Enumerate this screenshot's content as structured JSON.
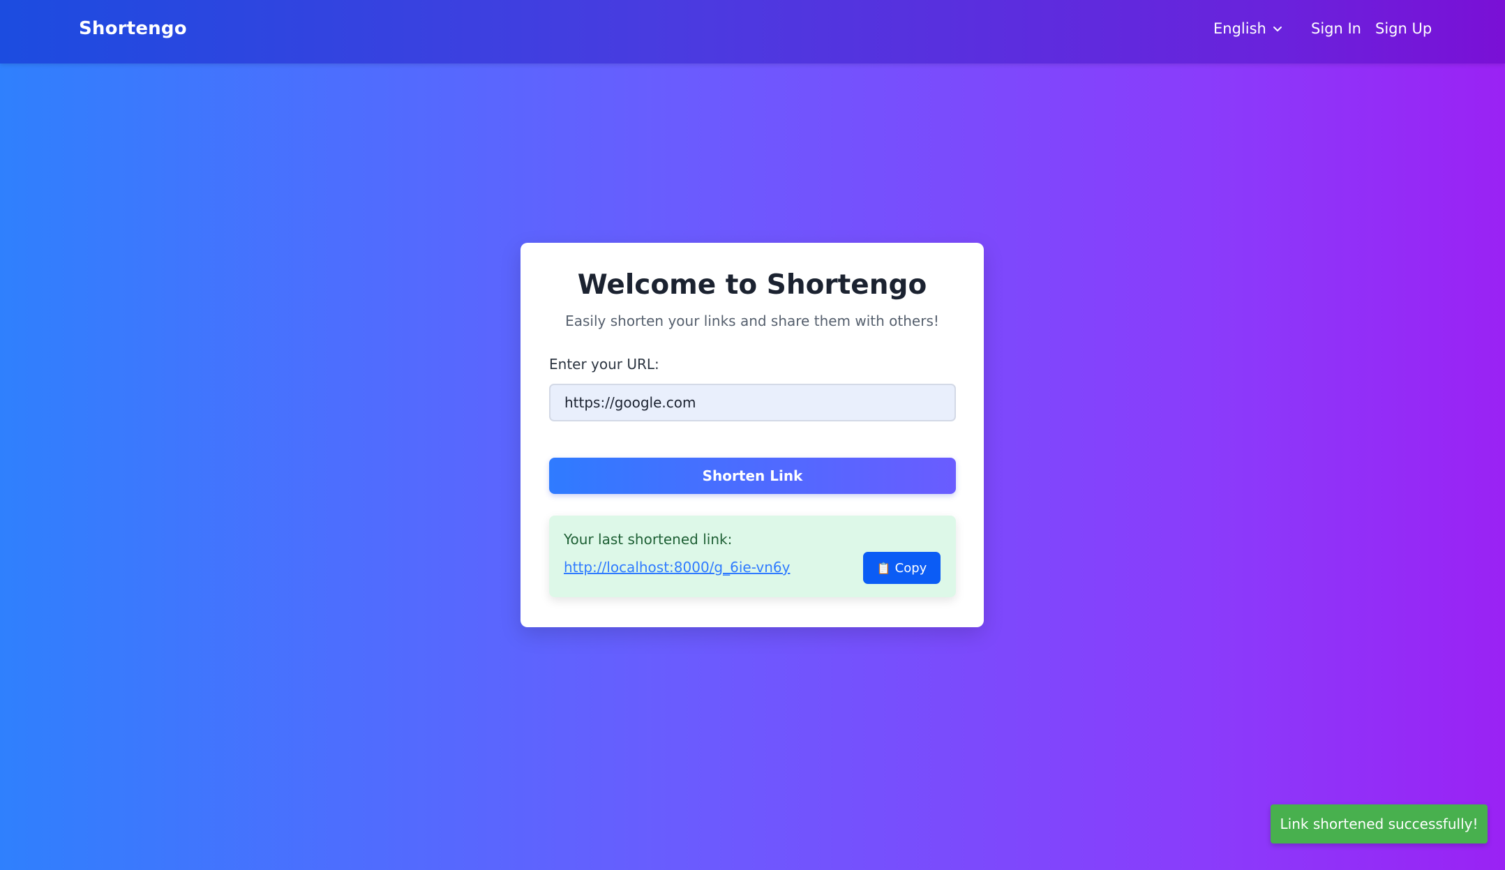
{
  "navbar": {
    "brand": "Shortengo",
    "language": "English",
    "sign_in": "Sign In",
    "sign_up": "Sign Up"
  },
  "card": {
    "title": "Welcome to Shortengo",
    "subtitle": "Easily shorten your links and share them with others!",
    "url_label": "Enter your URL:",
    "url_value": "https://google.com",
    "shorten_button": "Shorten Link",
    "result": {
      "label": "Your last shortened link:",
      "link": "http://localhost:8000/g_6ie-vn6y",
      "copy_icon": "📋",
      "copy_label": "Copy"
    }
  },
  "toast": {
    "message": "Link shortened successfully!"
  },
  "colors": {
    "primary": "#2f7bff",
    "accent": "#6a5cff",
    "copy_button": "#0b5cf5",
    "success": "#48b04e",
    "result_bg": "#ddf8e8"
  },
  "icons": {
    "language_dropdown": "chevron-down-icon",
    "copy": "clipboard-icon"
  }
}
